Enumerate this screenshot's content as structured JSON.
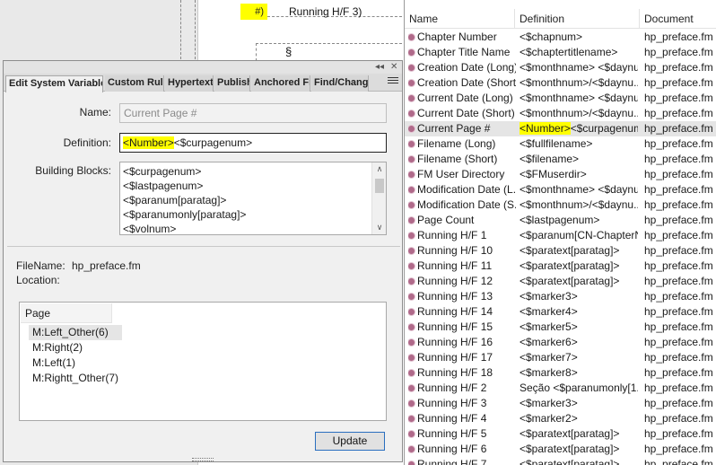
{
  "doc": {
    "marker_text": "#)",
    "running_text": "Running H/F 3)",
    "section_mark": "§"
  },
  "dialog": {
    "tabs": [
      "Edit System Variable",
      "Custom Ruli",
      "Hypertext",
      "Publish",
      "Anchored Fra",
      "Find/Change"
    ],
    "name_label": "Name:",
    "name_value": "Current Page #",
    "definition_label": "Definition:",
    "definition_hl": "<Number>",
    "definition_rest": "<$curpagenum>",
    "blocks_label": "Building Blocks:",
    "blocks": [
      "<$curpagenum>",
      "<$lastpagenum>",
      "<$paranum[paratag]>",
      "<$paranumonly[paratag]>",
      "<$volnum>"
    ],
    "filename_label": "FileName:",
    "filename_value": "hp_preface.fm",
    "location_label": "Location:",
    "page_header": "Page",
    "pages": [
      "M:Left_Other(6)",
      "M:Right(2)",
      "M:Left(1)",
      "M:Rightt_Other(7)"
    ],
    "update_label": "Update"
  },
  "list": {
    "columns": [
      "Name",
      "Definition",
      "Document"
    ],
    "rows": [
      {
        "name": "Chapter Number",
        "def": "<$chapnum>",
        "doc": "hp_preface.fm"
      },
      {
        "name": "Chapter Title Name",
        "def": "<$chaptertitlename>",
        "doc": "hp_preface.fm"
      },
      {
        "name": "Creation Date (Long)",
        "def": "<$monthname> <$daynu...",
        "doc": "hp_preface.fm"
      },
      {
        "name": "Creation Date (Short)",
        "def": "<$monthnum>/<$daynu...",
        "doc": "hp_preface.fm"
      },
      {
        "name": "Current Date (Long)",
        "def": "<$monthname> <$daynu...",
        "doc": "hp_preface.fm"
      },
      {
        "name": "Current Date (Short)",
        "def": "<$monthnum>/<$daynu...",
        "doc": "hp_preface.fm"
      },
      {
        "name": "Current Page #",
        "def_hl": "<Number>",
        "def": "<$curpagenum>",
        "doc": "hp_preface.fm"
      },
      {
        "name": "Filename (Long)",
        "def": "<$fullfilename>",
        "doc": "hp_preface.fm"
      },
      {
        "name": "Filename (Short)",
        "def": "<$filename>",
        "doc": "hp_preface.fm"
      },
      {
        "name": "FM User Directory",
        "def": "<$FMuserdir>",
        "doc": "hp_preface.fm"
      },
      {
        "name": "Modification Date (L...",
        "def": "<$monthname> <$daynu...",
        "doc": "hp_preface.fm"
      },
      {
        "name": "Modification Date (S...",
        "def": "<$monthnum>/<$daynu...",
        "doc": "hp_preface.fm"
      },
      {
        "name": "Page Count",
        "def": "<$lastpagenum>",
        "doc": "hp_preface.fm"
      },
      {
        "name": "Running H/F 1",
        "def": "<$paranum[CN-ChapterN...",
        "doc": "hp_preface.fm"
      },
      {
        "name": "Running H/F 10",
        "def": "<$paratext[paratag]>",
        "doc": "hp_preface.fm"
      },
      {
        "name": "Running H/F 11",
        "def": "<$paratext[paratag]>",
        "doc": "hp_preface.fm"
      },
      {
        "name": "Running H/F 12",
        "def": "<$paratext[paratag]>",
        "doc": "hp_preface.fm"
      },
      {
        "name": "Running H/F 13",
        "def": "<$marker3>",
        "doc": "hp_preface.fm"
      },
      {
        "name": "Running H/F 14",
        "def": "<$marker4>",
        "doc": "hp_preface.fm"
      },
      {
        "name": "Running H/F 15",
        "def": "<$marker5>",
        "doc": "hp_preface.fm"
      },
      {
        "name": "Running H/F 16",
        "def": "<$marker6>",
        "doc": "hp_preface.fm"
      },
      {
        "name": "Running H/F 17",
        "def": "<$marker7>",
        "doc": "hp_preface.fm"
      },
      {
        "name": "Running H/F 18",
        "def": "<$marker8>",
        "doc": "hp_preface.fm"
      },
      {
        "name": "Running H/F 2",
        "def": "Seção <$paranumonly[1...",
        "doc": "hp_preface.fm"
      },
      {
        "name": "Running H/F 3",
        "def": "<$marker3>",
        "doc": "hp_preface.fm"
      },
      {
        "name": "Running H/F 4",
        "def": "<$marker2>",
        "doc": "hp_preface.fm"
      },
      {
        "name": "Running H/F 5",
        "def": "<$paratext[paratag]>",
        "doc": "hp_preface.fm"
      },
      {
        "name": "Running H/F 6",
        "def": "<$paratext[paratag]>",
        "doc": "hp_preface.fm"
      },
      {
        "name": "Running H/F 7",
        "def": "<$paratext[paratag]>",
        "doc": "hp_preface.fm"
      }
    ]
  },
  "colors": {
    "highlight": "#ffff00",
    "accent_border": "#2a6fbf",
    "variable_icon": "#b06a8a"
  },
  "icons": {
    "variable": "system-variable-icon",
    "collapse": "collapse-double-arrow-icon",
    "close": "close-icon",
    "menu": "panel-menu-icon"
  }
}
